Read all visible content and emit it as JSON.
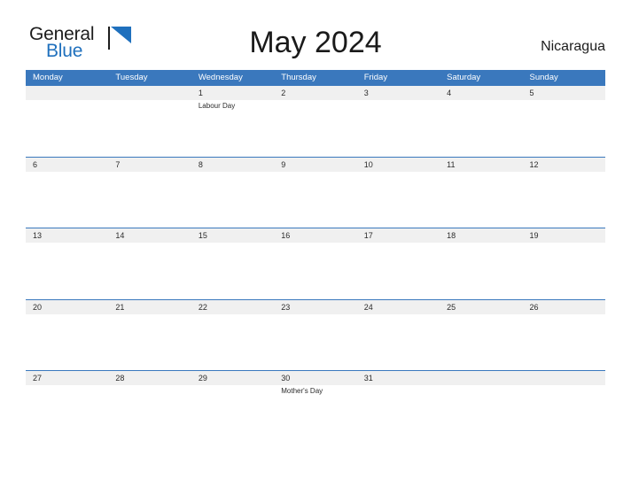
{
  "logo": {
    "word_top": "General",
    "word_bottom": "Blue",
    "flag_icon": "blue-triangle-flag-icon",
    "accent_color": "#1f70bd"
  },
  "header": {
    "title": "May 2024",
    "country": "Nicaragua"
  },
  "theme": {
    "header_blue": "#3a78bd",
    "row_strip_gray": "#f0f0f0",
    "text_dark": "#2b2b2b",
    "page_background": "#ffffff"
  },
  "calendar": {
    "month": "May",
    "year": "2024",
    "weekday_headers": [
      "Monday",
      "Tuesday",
      "Wednesday",
      "Thursday",
      "Friday",
      "Saturday",
      "Sunday"
    ],
    "weeks": [
      [
        {
          "date": "",
          "event": ""
        },
        {
          "date": "",
          "event": ""
        },
        {
          "date": "1",
          "event": "Labour Day"
        },
        {
          "date": "2",
          "event": ""
        },
        {
          "date": "3",
          "event": ""
        },
        {
          "date": "4",
          "event": ""
        },
        {
          "date": "5",
          "event": ""
        }
      ],
      [
        {
          "date": "6",
          "event": ""
        },
        {
          "date": "7",
          "event": ""
        },
        {
          "date": "8",
          "event": ""
        },
        {
          "date": "9",
          "event": ""
        },
        {
          "date": "10",
          "event": ""
        },
        {
          "date": "11",
          "event": ""
        },
        {
          "date": "12",
          "event": ""
        }
      ],
      [
        {
          "date": "13",
          "event": ""
        },
        {
          "date": "14",
          "event": ""
        },
        {
          "date": "15",
          "event": ""
        },
        {
          "date": "16",
          "event": ""
        },
        {
          "date": "17",
          "event": ""
        },
        {
          "date": "18",
          "event": ""
        },
        {
          "date": "19",
          "event": ""
        }
      ],
      [
        {
          "date": "20",
          "event": ""
        },
        {
          "date": "21",
          "event": ""
        },
        {
          "date": "22",
          "event": ""
        },
        {
          "date": "23",
          "event": ""
        },
        {
          "date": "24",
          "event": ""
        },
        {
          "date": "25",
          "event": ""
        },
        {
          "date": "26",
          "event": ""
        }
      ],
      [
        {
          "date": "27",
          "event": ""
        },
        {
          "date": "28",
          "event": ""
        },
        {
          "date": "29",
          "event": ""
        },
        {
          "date": "30",
          "event": "Mother's Day"
        },
        {
          "date": "31",
          "event": ""
        },
        {
          "date": "",
          "event": ""
        },
        {
          "date": "",
          "event": ""
        }
      ]
    ]
  }
}
